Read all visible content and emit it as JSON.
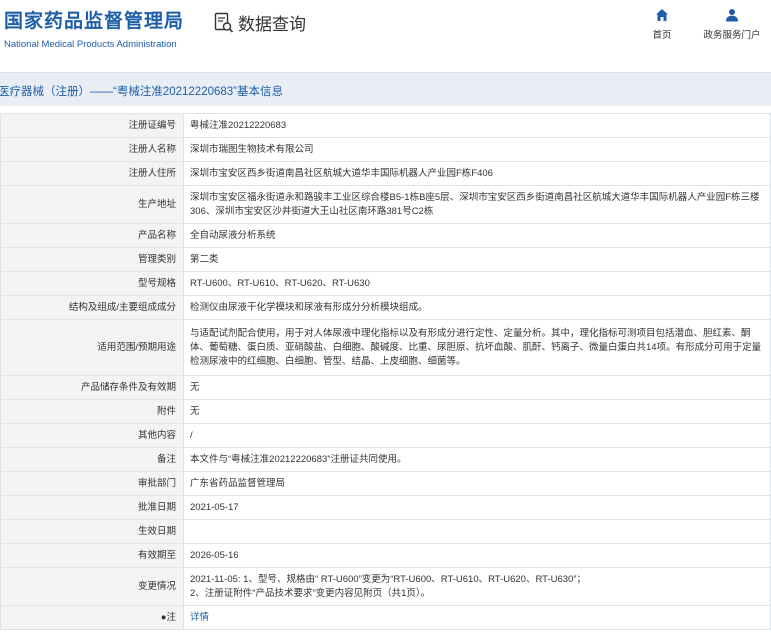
{
  "header": {
    "logo_cn": "国家药品监督管理局",
    "logo_en": "National Medical Products Administration",
    "query_label": "数据查询",
    "nav_home": "首页",
    "nav_gov": "政务服务门户",
    "accent": "#1f5ea8"
  },
  "titlebar": {
    "text": "医疗器械（注册）——“粤械注准20212220683”基本信息"
  },
  "rows": [
    {
      "label": "注册证编号",
      "value": "粤械注准20212220683"
    },
    {
      "label": "注册人名称",
      "value": "深圳市瑞图生物技术有限公司"
    },
    {
      "label": "注册人住所",
      "value": "深圳市宝安区西乡街道南昌社区航城大道华丰国际机器人产业园F栋F406"
    },
    {
      "label": "生产地址",
      "value": "深圳市宝安区福永街道永和路骏丰工业区综合楼B5-1栋B座5层、深圳市宝安区西乡街道南昌社区航城大道华丰国际机器人产业园F栋三楼306、深圳市宝安区沙井街道大王山社区南环路381号C2栋"
    },
    {
      "label": "产品名称",
      "value": "全自动尿液分析系统"
    },
    {
      "label": "管理类别",
      "value": "第二类"
    },
    {
      "label": "型号规格",
      "value": "RT-U600、RT-U610、RT-U620、RT-U630"
    },
    {
      "label": "结构及组成/主要组成成分",
      "value": "检测仪由尿液干化学模块和尿液有形成分分析模块组成。"
    },
    {
      "label": "适用范围/预期用途",
      "value": "与适配试剂配合使用，用于对人体尿液中理化指标以及有形成分进行定性、定量分析。其中，理化指标可测项目包括潜血、胆红素、酮体、葡萄糖、蛋白质、亚硝酸盐、白细胞、酸碱度、比重、尿胆原、抗坏血酸、肌酐、钙离子、微量白蛋白共14项。有形成分可用于定量检测尿液中的红细胞、白细胞、管型、结晶、上皮细胞、细菌等。"
    },
    {
      "label": "产品储存条件及有效期",
      "value": "无"
    },
    {
      "label": "附件",
      "value": "无"
    },
    {
      "label": "其他内容",
      "value": "/"
    },
    {
      "label": "备注",
      "value": "本文件与“粤械注准20212220683”注册证共同使用。"
    },
    {
      "label": "审批部门",
      "value": "广东省药品监督管理局"
    },
    {
      "label": "批准日期",
      "value": "2021-05-17"
    },
    {
      "label": "生效日期",
      "value": ""
    },
    {
      "label": "有效期至",
      "value": "2026-05-16"
    },
    {
      "label": "变更情况",
      "value_lines": [
        "2021-11-05: 1、型号、规格由“ RT-U600”变更为“RT-U600、RT-U610、RT-U620、RT-U630”；",
        "2、注册证附件“产品技术要求”变更内容见附页（共1页）。"
      ]
    },
    {
      "label": "●注",
      "value": "详情"
    }
  ]
}
